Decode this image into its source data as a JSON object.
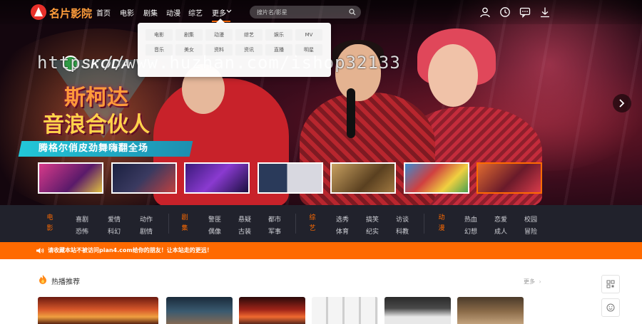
{
  "header": {
    "logo_text": "名片影院",
    "nav": [
      {
        "label": "首页"
      },
      {
        "label": "电影"
      },
      {
        "label": "剧集"
      },
      {
        "label": "动漫"
      },
      {
        "label": "综艺"
      },
      {
        "label": "更多"
      }
    ],
    "search_placeholder": "搜片名/影星"
  },
  "dropdown": {
    "items": [
      "电影",
      "剧集",
      "动漫",
      "综艺",
      "娱乐",
      "MV",
      "音乐",
      "美女",
      "资料",
      "资讯",
      "直播",
      "明星"
    ]
  },
  "hero": {
    "sponsor": "SKODA",
    "title_line1": "斯柯达",
    "title_line2": "音浪合伙人",
    "subtitle": "腾格尔俏皮劲舞嗨翻全场",
    "watermark": "https://www.huzhan.com/ishop32133",
    "thumb_count": 8,
    "active_thumb": 8
  },
  "categories": [
    {
      "head": "电影",
      "links": [
        "喜剧",
        "爱情",
        "动作",
        "恐怖",
        "科幻",
        "剧情"
      ]
    },
    {
      "head": "剧集",
      "links": [
        "警匪",
        "悬疑",
        "都市",
        "偶像",
        "古装",
        "军事"
      ]
    },
    {
      "head": "综艺",
      "links": [
        "选秀",
        "搞笑",
        "访谈",
        "体育",
        "纪实",
        "科教"
      ]
    },
    {
      "head": "动漫",
      "links": [
        "热血",
        "恋爱",
        "校园",
        "幻想",
        "成人",
        "冒险"
      ]
    }
  ],
  "notice": {
    "text": "请收藏本站不被访问pian4.com给你的朋友！让本站走的更远！"
  },
  "hot": {
    "title": "热播推荐",
    "more": "更多"
  },
  "colors": {
    "accent": "#ff6a00",
    "catbar_bg": "#21222c",
    "logo_red": "#e8302a"
  }
}
